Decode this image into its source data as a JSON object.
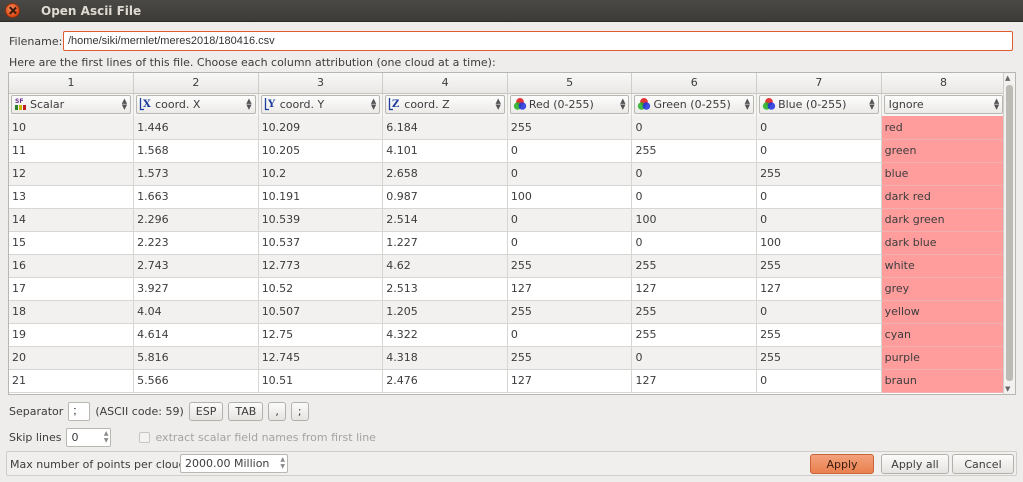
{
  "window": {
    "title": "Open Ascii File"
  },
  "filename": {
    "label": "Filename:",
    "value": "/home/siki/mernlet/meres2018/180416.csv"
  },
  "hint": "Here are the first lines of this file. Choose each column attribution (one cloud at a time):",
  "columns": [
    "1",
    "2",
    "3",
    "4",
    "5",
    "6",
    "7",
    "8"
  ],
  "attributions": [
    {
      "label": "Scalar",
      "icon": "scalar-field-icon"
    },
    {
      "label": "coord. X",
      "icon": "coord-x-icon"
    },
    {
      "label": "coord. Y",
      "icon": "coord-y-icon"
    },
    {
      "label": "coord. Z",
      "icon": "coord-z-icon"
    },
    {
      "label": "Red (0-255)",
      "icon": "rgb-color-icon"
    },
    {
      "label": "Green (0-255)",
      "icon": "rgb-color-icon"
    },
    {
      "label": "Blue (0-255)",
      "icon": "rgb-color-icon"
    },
    {
      "label": "Ignore",
      "icon": ""
    }
  ],
  "rows": [
    [
      "10",
      "1.446",
      "10.209",
      "6.184",
      "255",
      "0",
      "0",
      "red"
    ],
    [
      "11",
      "1.568",
      "10.205",
      "4.101",
      "0",
      "255",
      "0",
      "green"
    ],
    [
      "12",
      "1.573",
      "10.2",
      "2.658",
      "0",
      "0",
      "255",
      "blue"
    ],
    [
      "13",
      "1.663",
      "10.191",
      "0.987",
      "100",
      "0",
      "0",
      "dark red"
    ],
    [
      "14",
      "2.296",
      "10.539",
      "2.514",
      "0",
      "100",
      "0",
      "dark green"
    ],
    [
      "15",
      "2.223",
      "10.537",
      "1.227",
      "0",
      "0",
      "100",
      "dark blue"
    ],
    [
      "16",
      "2.743",
      "12.773",
      "4.62",
      "255",
      "255",
      "255",
      "white"
    ],
    [
      "17",
      "3.927",
      "10.52",
      "2.513",
      "127",
      "127",
      "127",
      "grey"
    ],
    [
      "18",
      "4.04",
      "10.507",
      "1.205",
      "255",
      "255",
      "0",
      "yellow"
    ],
    [
      "19",
      "4.614",
      "12.75",
      "4.322",
      "0",
      "255",
      "255",
      "cyan"
    ],
    [
      "20",
      "5.816",
      "12.745",
      "4.318",
      "255",
      "0",
      "255",
      "purple"
    ],
    [
      "21",
      "5.566",
      "10.51",
      "2.476",
      "127",
      "127",
      "0",
      "braun"
    ]
  ],
  "separator": {
    "label": "Separator",
    "value": ";",
    "ascii_code": "(ASCII code: 59)",
    "buttons": [
      "ESP",
      "TAB",
      ",",
      ";"
    ]
  },
  "skip_lines": {
    "label": "Skip lines",
    "value": "0"
  },
  "extract_names_checkbox": {
    "label": "extract scalar field names from first line",
    "checked": false
  },
  "max_points": {
    "label": "Max number of points per cloud",
    "value": "2000.00 Million"
  },
  "buttons": {
    "apply": "Apply",
    "apply_all": "Apply all",
    "cancel": "Cancel"
  },
  "colors": {
    "accent": "#e9804f",
    "ignored_column": "#ff9d9d",
    "titlebar": "#3c3b37"
  }
}
